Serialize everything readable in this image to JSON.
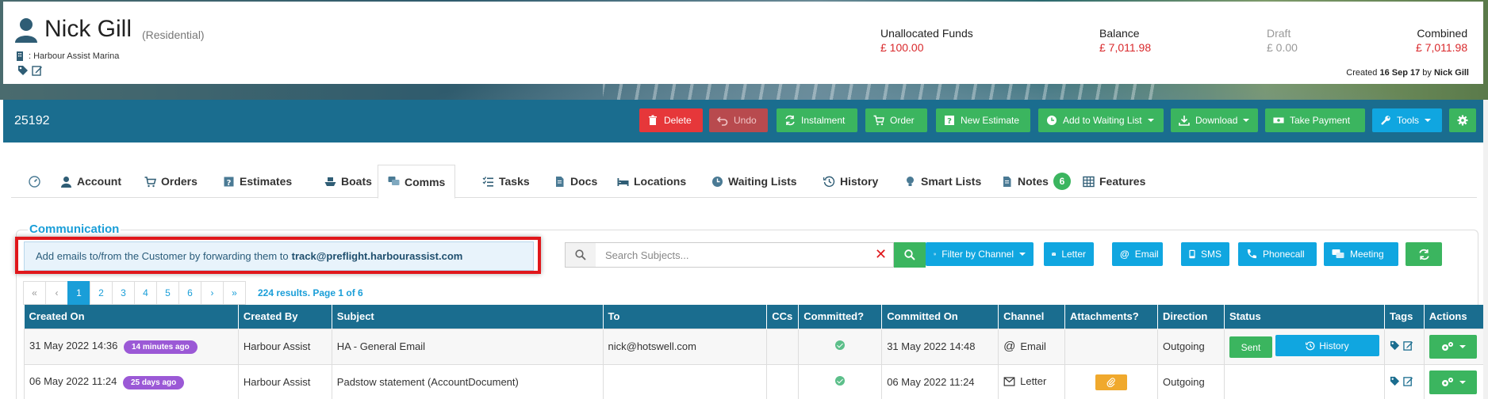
{
  "customer": {
    "name": "Nick Gill",
    "type": "(Residential)",
    "site": ": Harbour Assist Marina",
    "created_prefix": "Created",
    "created_date": "16 Sep 17",
    "created_by_prefix": "by",
    "created_by": "Nick Gill"
  },
  "funds": [
    {
      "label": "Unallocated Funds",
      "value": "£ 100.00"
    },
    {
      "label": "Balance",
      "value": "£ 7,011.98"
    },
    {
      "label": "Draft",
      "value": "£ 0.00"
    },
    {
      "label": "Combined",
      "value": "£ 7,011.98"
    }
  ],
  "toolbar": {
    "account_number": "25192",
    "delete": "Delete",
    "undo": "Undo",
    "instalment": "Instalment",
    "order": "Order",
    "new_estimate": "New Estimate",
    "add_waiting": "Add to Waiting List",
    "download": "Download",
    "take_payment": "Take Payment",
    "tools": "Tools"
  },
  "tabs": {
    "account": "Account",
    "orders": "Orders",
    "estimates": "Estimates",
    "boats": "Boats",
    "comms": "Comms",
    "tasks": "Tasks",
    "docs": "Docs",
    "locations": "Locations",
    "waiting_lists": "Waiting Lists",
    "history": "History",
    "smart_lists": "Smart Lists",
    "notes": "Notes",
    "notes_count": "6",
    "features": "Features"
  },
  "comms": {
    "title": "Communication",
    "info_text": "Add emails to/from the Customer by forwarding them to",
    "info_email": "track@preflight.harbourassist.com",
    "search_placeholder": "Search Subjects...",
    "filter_channel": "Filter by Channel",
    "letter": "Letter",
    "email": "Email",
    "sms": "SMS",
    "phonecall": "Phonecall",
    "meeting": "Meeting"
  },
  "pager": {
    "first": "«",
    "prev": "‹",
    "pages": [
      "1",
      "2",
      "3",
      "4",
      "5",
      "6"
    ],
    "next": "›",
    "last": "»",
    "summary": "224 results. Page 1 of 6"
  },
  "table": {
    "headers": [
      "Created On",
      "Created By",
      "Subject",
      "To",
      "CCs",
      "Committed?",
      "Committed On",
      "Channel",
      "Attachments?",
      "Direction",
      "Status",
      "Tags",
      "Actions"
    ],
    "rows": [
      {
        "created_on": "31 May 2022 14:36",
        "age": "14 minutes ago",
        "created_by": "Harbour Assist",
        "subject": "HA - General Email",
        "to": "nick@hotswell.com",
        "committed_on": "31 May 2022 14:48",
        "channel": "Email",
        "direction": "Outgoing",
        "status_sent": "Sent",
        "status_history": "History"
      },
      {
        "created_on": "06 May 2022 11:24",
        "age": "25 days ago",
        "created_by": "Harbour Assist",
        "subject": "Padstow statement (AccountDocument)",
        "to": "",
        "committed_on": "06 May 2022 11:24",
        "channel": "Letter",
        "direction": "Outgoing"
      }
    ]
  },
  "colors": {
    "primary": "#1a6d8f",
    "accent_blue": "#10a6e0",
    "green": "#3bb55f",
    "red": "#e6373a",
    "money_red": "#d9282b",
    "purple_pill": "#9b59d6",
    "highlight_red": "#e0171b"
  }
}
